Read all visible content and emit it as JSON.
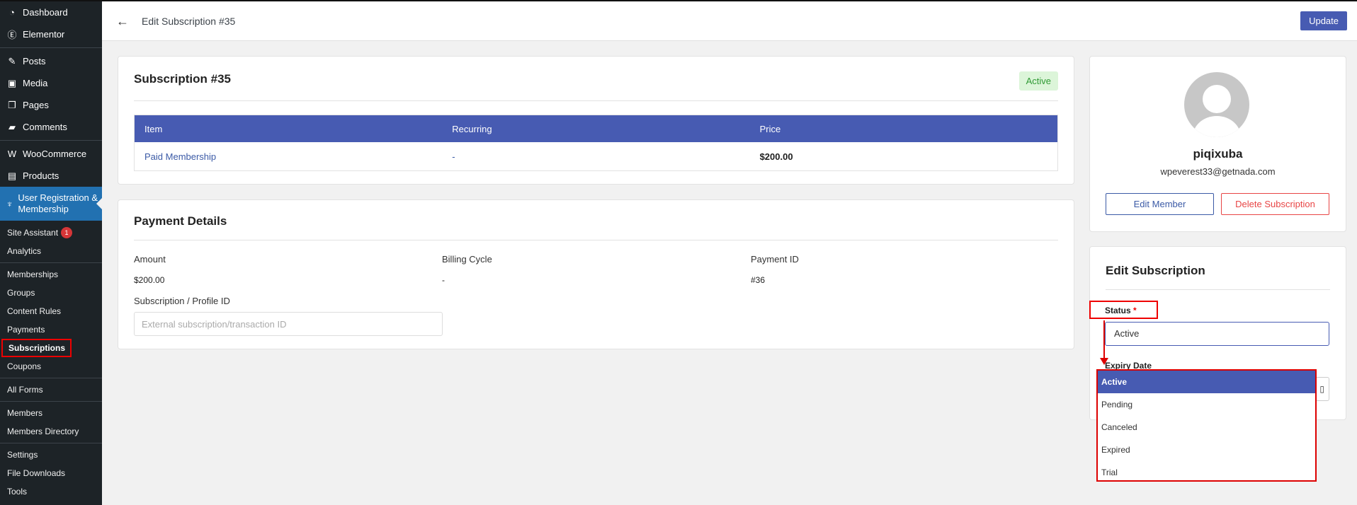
{
  "sidebar": {
    "main_items": [
      {
        "label": "Dashboard",
        "icon": "dashboard-icon"
      },
      {
        "label": "Elementor",
        "icon": "elementor-icon"
      },
      {
        "label": "Posts",
        "icon": "pin-icon"
      },
      {
        "label": "Media",
        "icon": "media-icon"
      },
      {
        "label": "Pages",
        "icon": "pages-icon"
      },
      {
        "label": "Comments",
        "icon": "comment-icon"
      },
      {
        "label": "WooCommerce",
        "icon": "woocommerce-icon"
      },
      {
        "label": "Products",
        "icon": "products-icon"
      }
    ],
    "active_item": {
      "label": "User Registration & Membership",
      "icon": "user-registration-icon"
    },
    "sub_items": {
      "site_assistant": "Site Assistant",
      "site_assistant_badge": "1",
      "analytics": "Analytics",
      "memberships": "Memberships",
      "groups": "Groups",
      "content_rules": "Content Rules",
      "payments": "Payments",
      "subscriptions": "Subscriptions",
      "coupons": "Coupons",
      "all_forms": "All Forms",
      "members": "Members",
      "members_directory": "Members Directory",
      "settings": "Settings",
      "file_downloads": "File Downloads",
      "tools": "Tools"
    }
  },
  "header": {
    "title": "Edit Subscription #35",
    "update_label": "Update"
  },
  "subscription_card": {
    "title": "Subscription #35",
    "status_badge": "Active",
    "columns": [
      "Item",
      "Recurring",
      "Price"
    ],
    "row": {
      "item": "Paid Membership",
      "recurring": "-",
      "price": "$200.00"
    }
  },
  "payment_card": {
    "title": "Payment Details",
    "amount_label": "Amount",
    "amount_value": "$200.00",
    "billing_label": "Billing Cycle",
    "billing_value": "-",
    "payment_id_label": "Payment ID",
    "payment_id_value": "#36",
    "profile_label": "Subscription / Profile ID",
    "profile_placeholder": "External subscription/transaction ID"
  },
  "member_card": {
    "username": "piqixuba",
    "email": "wpeverest33@getnada.com",
    "edit_label": "Edit Member",
    "delete_label": "Delete Subscription"
  },
  "edit_card": {
    "title": "Edit Subscription",
    "status_label": "Status",
    "required_mark": "*",
    "status_value": "Active",
    "expiry_label": "Expiry Date",
    "options": [
      "Active",
      "Pending",
      "Canceled",
      "Expired",
      "Trial"
    ]
  },
  "colors": {
    "accent": "#475bb2",
    "sidebar": "#1d2327",
    "active_menu": "#2271b1",
    "highlight": "#e00000"
  }
}
